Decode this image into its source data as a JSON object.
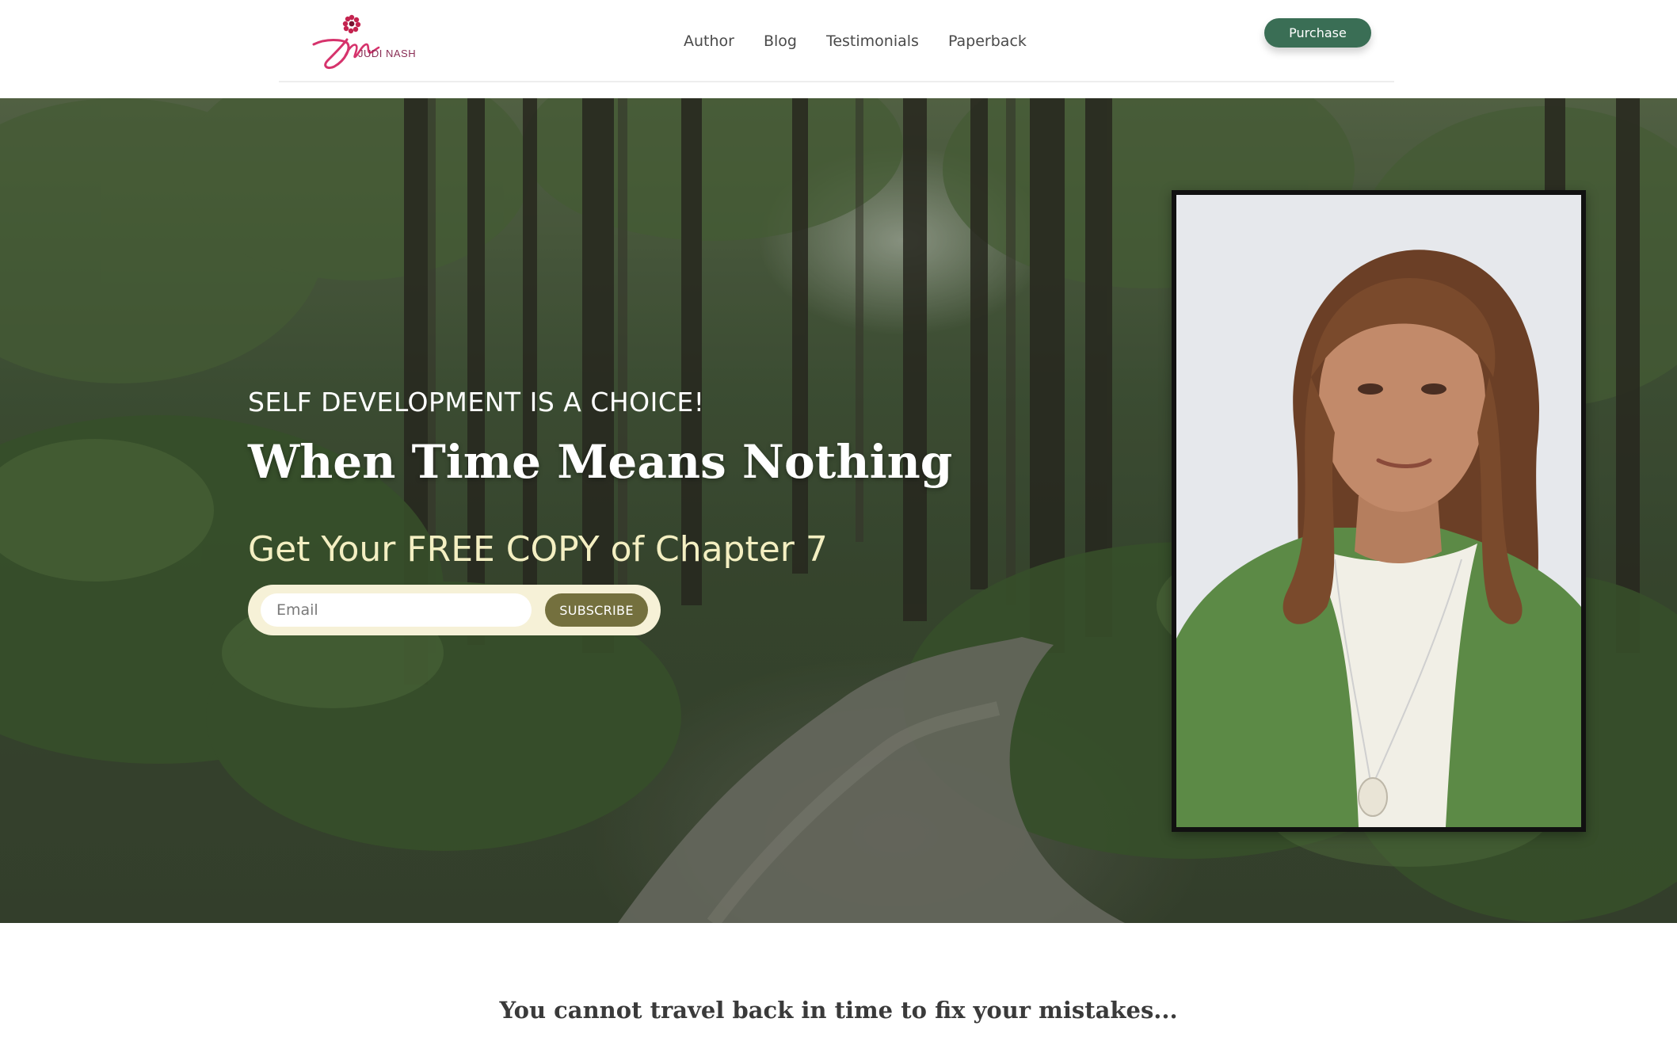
{
  "brand": {
    "logo_text": "JUDI NASH"
  },
  "nav": {
    "items": [
      {
        "label": "Author"
      },
      {
        "label": "Blog"
      },
      {
        "label": "Testimonials"
      },
      {
        "label": "Paperback"
      }
    ]
  },
  "header": {
    "purchase_label": "Purchase"
  },
  "hero": {
    "eyebrow": "SELF DEVELOPMENT IS A CHOICE!",
    "title": "When Time Means Nothing",
    "offer": "Get Your FREE COPY of Chapter 7",
    "email_placeholder": "Email",
    "subscribe_label": "SUBSCRIBE"
  },
  "section": {
    "tagline": "You cannot travel back in time to fix your mistakes..."
  },
  "colors": {
    "accent_green": "#3a6e55",
    "subscribe_olive": "#74703e",
    "offer_cream": "#f4efc2",
    "logo_pink": "#d6336c"
  }
}
